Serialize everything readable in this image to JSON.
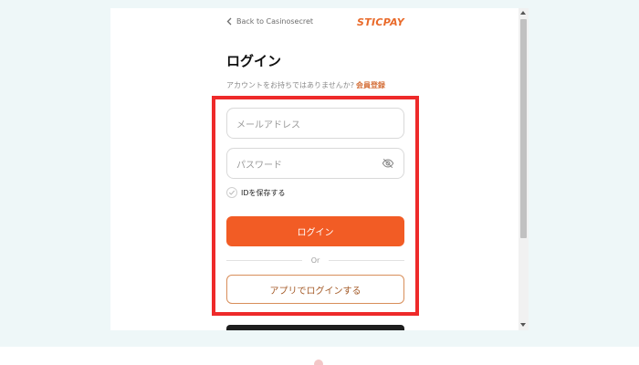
{
  "header": {
    "back_label": "Back to Casinosecret",
    "brand": "STICPAY"
  },
  "login": {
    "title": "ログイン",
    "signup_prompt": "アカウントをお持ちではありませんか?",
    "signup_link": "会員登録",
    "email_placeholder": "メールアドレス",
    "password_placeholder": "パスワード",
    "remember_label": "IDを保存する",
    "login_button": "ログイン",
    "or_label": "Or",
    "app_login_button": "アプリでログインする"
  },
  "icons": {
    "back": "chevron-left-icon",
    "password_visibility": "eye-off-icon",
    "checkbox": "check-icon"
  },
  "colors": {
    "accent": "#f25c25",
    "brand": "#e96a2a",
    "signup_link": "#d5703a",
    "highlight": "#ee2a2a"
  }
}
